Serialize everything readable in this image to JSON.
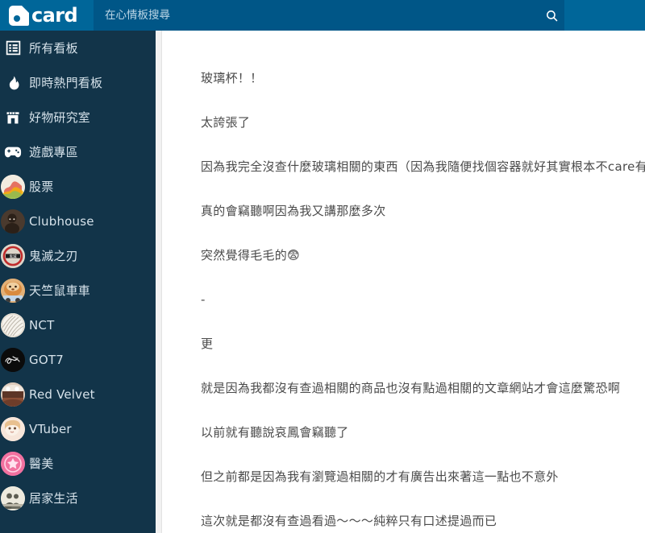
{
  "header": {
    "logo_text": "card",
    "logo_icon": "dcard-logo-icon",
    "search_placeholder": "在心情板搜尋",
    "search_value": "",
    "search_icon": "search-icon"
  },
  "sidebar": {
    "items": [
      {
        "label": "所有看板",
        "icon": "list-board-icon",
        "type": "icon",
        "color": "#ffffff"
      },
      {
        "label": "即時熱門看板",
        "icon": "flame-icon",
        "type": "icon",
        "color": "#ffffff"
      },
      {
        "label": "好物研究室",
        "icon": "shop-icon",
        "type": "icon",
        "color": "#ffffff"
      },
      {
        "label": "遊戲專區",
        "icon": "gamepad-icon",
        "type": "icon",
        "color": "#ffffff"
      },
      {
        "label": "股票",
        "icon": "board-avatar-stock",
        "type": "avatar",
        "color": "#e8e0d2"
      },
      {
        "label": "Clubhouse",
        "icon": "board-avatar-clubhouse",
        "type": "avatar",
        "color": "#4a3a30"
      },
      {
        "label": "鬼滅之刃",
        "icon": "board-avatar-demonslayer",
        "type": "avatar",
        "color": "#d9d2c6"
      },
      {
        "label": "天竺鼠車車",
        "icon": "board-avatar-pui",
        "type": "avatar",
        "color": "#d9a36a"
      },
      {
        "label": "NCT",
        "icon": "board-avatar-nct",
        "type": "avatar",
        "color": "#f2f0ec"
      },
      {
        "label": "GOT7",
        "icon": "board-avatar-got7",
        "type": "avatar",
        "color": "#0c0c0c"
      },
      {
        "label": "Red Velvet",
        "icon": "board-avatar-redvelvet",
        "type": "avatar",
        "color": "#cdb6a6"
      },
      {
        "label": "VTuber",
        "icon": "board-avatar-vtuber",
        "type": "avatar",
        "color": "#f3ddd2"
      },
      {
        "label": "醫美",
        "icon": "board-avatar-medbeauty",
        "type": "avatar",
        "color": "#f472b6"
      },
      {
        "label": "居家生活",
        "icon": "board-avatar-homelife",
        "type": "avatar",
        "color": "#e8e6df"
      }
    ]
  },
  "post": {
    "paragraphs": [
      "玻璃杯！！",
      "太誇張了",
      "因為我完全沒查什麼玻璃相關的東西（因為我隨便找個容器就好其實根本不care有沒有玻璃瓶QQ）",
      "真的會竊聽啊因為我又講那麼多次",
      "突然覺得毛毛的😨",
      "-",
      "更",
      "就是因為我都沒有查過相關的商品也沒有點過相關的文章網站才會這麼驚恐啊",
      "以前就有聽說哀鳳會竊聽了",
      "但之前都是因為我有瀏覽過相關的才有廣告出來著這一點也不意外",
      "這次就是都沒有查過看過～～～純粹只有口述提過而已"
    ]
  },
  "colors": {
    "header_bg": "#006699",
    "sidebar_bg": "#123449",
    "search_bg": "#005687",
    "text": "#4a4a4a"
  }
}
